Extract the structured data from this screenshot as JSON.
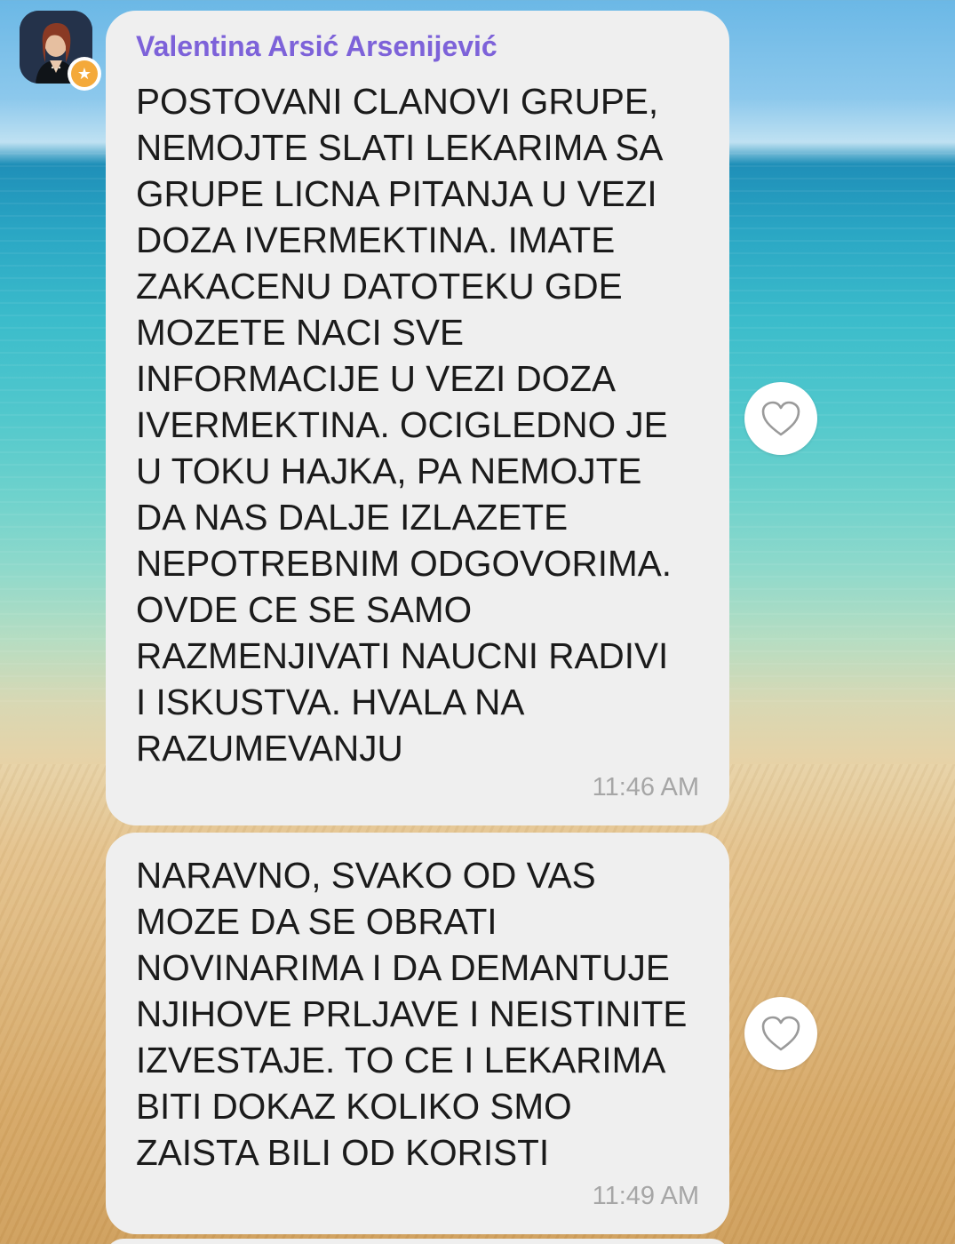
{
  "chat": {
    "messages": [
      {
        "sender": "Valentina Arsić Arsenijević",
        "text": "POSTOVANI CLANOVI GRUPE,\nNEMOJTE SLATI LEKARIMA SA\nGRUPE LICNA PITANJA U VEZI\nDOZA IVERMEKTINA. IMATE\nZAKACENU DATOTEKU GDE\nMOZETE NACI SVE\nINFORMACIJE U VEZI DOZA\nIVERMEKTINA. OCIGLEDNO JE\nU TOKU HAJKA, PA NEMOJTE\nDA NAS DALJE IZLAZETE\nNEPOTREBNIM ODGOVORIMA.\nOVDE CE SE SAMO\nRAZMENJIVATI NAUCNI RADIVI\nI ISKUSTVA. HVALA NA\nRAZUMEVANJU",
        "time": "11:46 AM"
      },
      {
        "text": "NARAVNO, SVAKO OD VAS\nMOZE DA SE OBRATI\nNOVINARIMA I DA DEMANTUJE\nNJIHOVE PRLJAVE I NEISTINITE\nIZVESTAJE. TO CE I LEKARIMA\nBITI DOKAZ KOLIKO SMO\nZAISTA BILI OD KORISTI",
        "time": "11:49 AM"
      }
    ]
  },
  "icons": {
    "avatar_badge": "star-icon",
    "like": "heart-outline-icon"
  },
  "colors": {
    "sender_name": "#7d62d9",
    "bubble": "#efefef",
    "badge": "#f4a93a",
    "timestamp": "#a6a6a6"
  }
}
